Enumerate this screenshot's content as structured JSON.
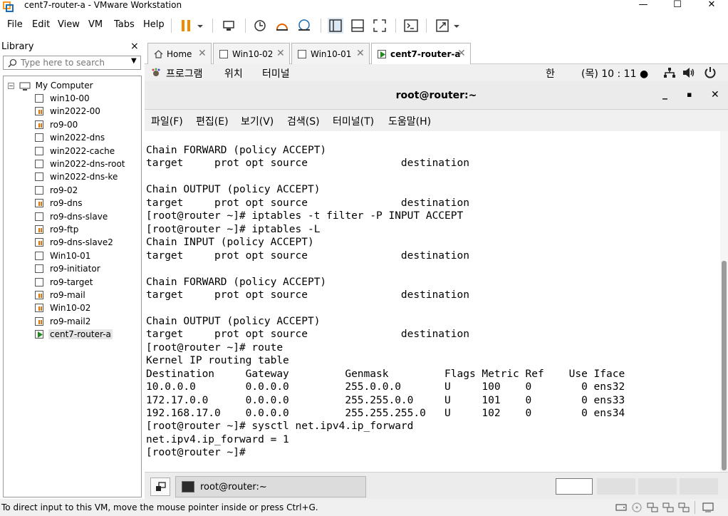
{
  "window": {
    "title": "cent7-router-a - VMware Workstation",
    "minimize": "—",
    "maximize": "☐",
    "close": "✕"
  },
  "menu": [
    "File",
    "Edit",
    "View",
    "VM",
    "Tabs",
    "Help"
  ],
  "library": {
    "title": "Library",
    "close": "×",
    "search_placeholder": "Type here to search",
    "root": "My Computer",
    "vms": [
      "win10-00",
      "win2022-00",
      "ro9-00",
      "win2022-dns",
      "win2022-cache",
      "win2022-dns-root",
      "win2022-dns-ke",
      "ro9-02",
      "ro9-dns",
      "ro9-dns-slave",
      "ro9-ftp",
      "ro9-dns-slave2",
      "Win10-01",
      "ro9-initiator",
      "ro9-target",
      "ro9-mail",
      "Win10-02",
      "ro9-mail2",
      "cent7-router-a"
    ],
    "selected": "cent7-router-a"
  },
  "tabs": [
    {
      "label": "Home"
    },
    {
      "label": "Win10-02"
    },
    {
      "label": "Win10-01"
    },
    {
      "label": "cent7-router-a"
    }
  ],
  "gnome": {
    "apps": "프로그램",
    "places": "위치",
    "terminal": "터미널",
    "input_method": "한",
    "clock": "(목) 10 : 11 ●"
  },
  "terminal": {
    "title": "root@router:~",
    "menu": [
      "파일(F)",
      "편집(E)",
      "보기(V)",
      "검색(S)",
      "터미널(T)",
      "도움말(H)"
    ],
    "lines": [
      "Chain FORWARD (policy ACCEPT)",
      "target     prot opt source               destination",
      "",
      "Chain OUTPUT (policy ACCEPT)",
      "target     prot opt source               destination",
      "[root@router ~]# iptables -t filter -P INPUT ACCEPT",
      "[root@router ~]# iptables -L",
      "Chain INPUT (policy ACCEPT)",
      "target     prot opt source               destination",
      "",
      "Chain FORWARD (policy ACCEPT)",
      "target     prot opt source               destination",
      "",
      "Chain OUTPUT (policy ACCEPT)",
      "target     prot opt source               destination",
      "[root@router ~]# route",
      "Kernel IP routing table",
      "Destination     Gateway         Genmask         Flags Metric Ref    Use Iface",
      "10.0.0.0        0.0.0.0         255.0.0.0       U     100    0        0 ens32",
      "172.17.0.0      0.0.0.0         255.255.0.0     U     101    0        0 ens33",
      "192.168.17.0    0.0.0.0         255.255.255.0   U     102    0        0 ens34",
      "[root@router ~]# sysctl net.ipv4.ip_forward",
      "net.ipv4.ip_forward = 1",
      "[root@router ~]# "
    ]
  },
  "taskbar": {
    "task": "root@router:~"
  },
  "status": {
    "text": "To direct input to this VM, move the mouse pointer inside or press Ctrl+G."
  },
  "colors": {
    "accent": "#1e8a1e",
    "pause": "#f08a00"
  }
}
